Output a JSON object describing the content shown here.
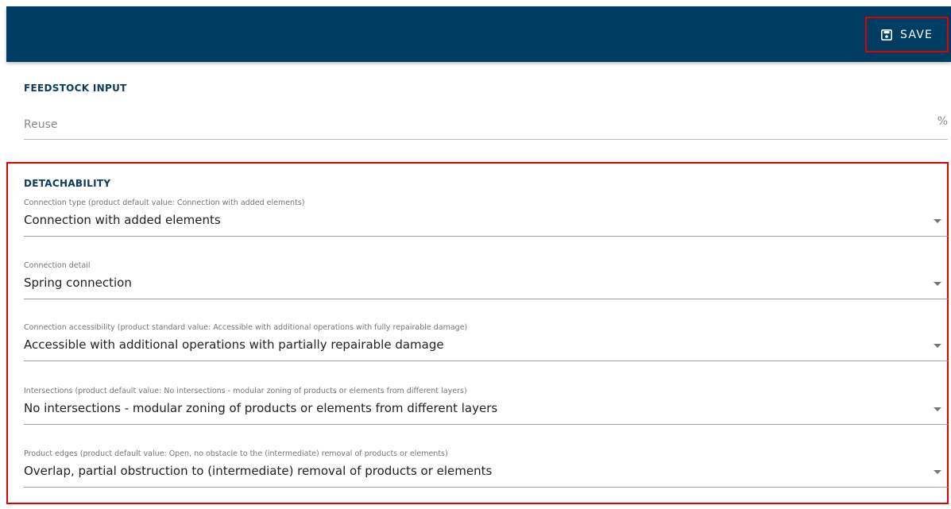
{
  "toolbar": {
    "save_label": "SAVE",
    "save_icon": "floppy-disk-icon",
    "bar_color": "#003d63"
  },
  "feedstock": {
    "title": "FEEDSTOCK INPUT",
    "reuse": {
      "placeholder": "Reuse",
      "value": "",
      "unit": "%"
    }
  },
  "detachability": {
    "title": "DETACHABILITY",
    "fields": [
      {
        "label": "Connection type (product default value: Connection with added elements)",
        "value": "Connection with added elements"
      },
      {
        "label": "Connection detail",
        "value": "Spring connection"
      },
      {
        "label": "Connection accessibility (product standard value: Accessible with additional operations with fully repairable damage)",
        "value": "Accessible with additional operations with partially repairable damage"
      },
      {
        "label": "Intersections (product default value: No intersections - modular zoning of products or elements from different layers)",
        "value": "No intersections - modular zoning of products or elements from different layers"
      },
      {
        "label": "Product edges (product default value: Open, no obstacle to the (intermediate) removal of products or elements)",
        "value": "Overlap, partial obstruction to (intermediate) removal of products or elements"
      }
    ]
  },
  "highlight_color": "#e00000"
}
